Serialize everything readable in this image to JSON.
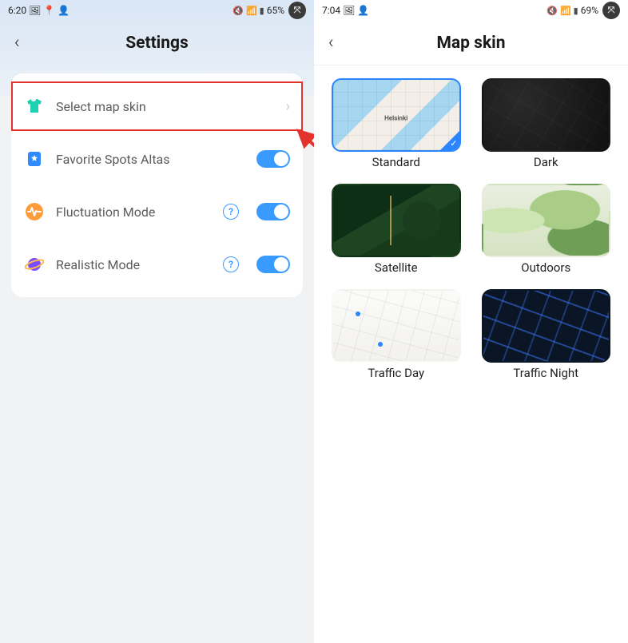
{
  "left": {
    "status": {
      "time": "6:20",
      "battery": "65%"
    },
    "header": {
      "title": "Settings"
    },
    "rows": {
      "mapskin": {
        "label": "Select map skin"
      },
      "favorite": {
        "label": "Favorite Spots Altas"
      },
      "fluct": {
        "label": "Fluctuation Mode"
      },
      "realistic": {
        "label": "Realistic Mode"
      }
    }
  },
  "right": {
    "status": {
      "time": "7:04",
      "battery": "69%"
    },
    "header": {
      "title": "Map skin"
    },
    "skins": {
      "standard": {
        "label": "Standard"
      },
      "dark": {
        "label": "Dark"
      },
      "satellite": {
        "label": "Satellite"
      },
      "outdoors": {
        "label": "Outdoors"
      },
      "trafficday": {
        "label": "Traffic Day"
      },
      "trafficnight": {
        "label": "Traffic Night"
      }
    }
  }
}
